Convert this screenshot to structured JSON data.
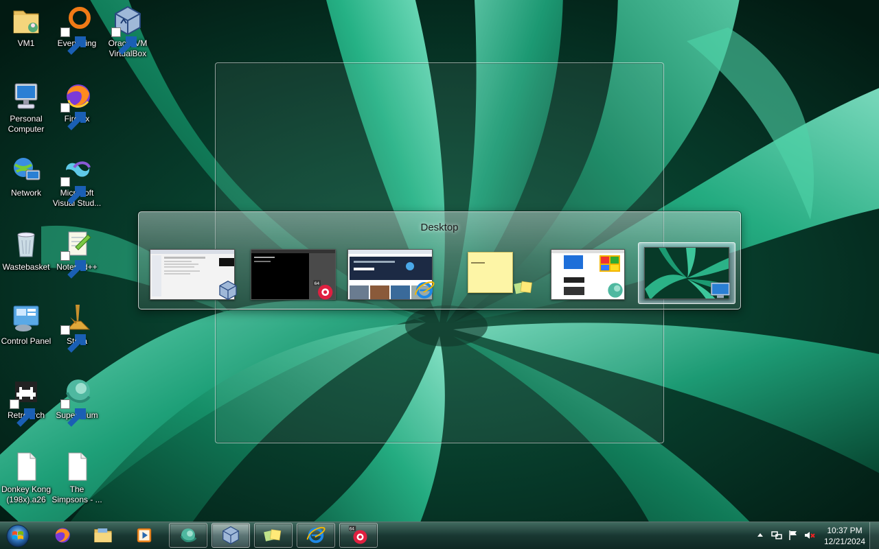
{
  "desktop": {
    "icons": [
      {
        "label": "VM1"
      },
      {
        "label": "Everything"
      },
      {
        "label": "Oracle VM VirtualBox"
      },
      {
        "label": "Personal Computer"
      },
      {
        "label": "Firefox"
      },
      {
        "label": "Network"
      },
      {
        "label": "Microsoft Visual Stud..."
      },
      {
        "label": "Wastebasket"
      },
      {
        "label": "Notepad++"
      },
      {
        "label": "Control Panel"
      },
      {
        "label": "Stella"
      },
      {
        "label": "RetroArch"
      },
      {
        "label": "Supermium"
      },
      {
        "label": "Donkey Kong (198x).a26"
      },
      {
        "label": "The Simpsons - ..."
      }
    ]
  },
  "switcher": {
    "title": "Desktop",
    "items": [
      {
        "app": "VirtualBox",
        "icon": "virtualbox-icon"
      },
      {
        "app": "RetroArch",
        "icon": "retroarch-icon"
      },
      {
        "app": "Internet Explorer",
        "icon": "ie-icon"
      },
      {
        "app": "Sticky Notes",
        "icon": "sticky-notes-icon"
      },
      {
        "app": "Supermium",
        "icon": "supermium-icon"
      },
      {
        "app": "Desktop",
        "icon": "desktop-icon",
        "selected": true
      }
    ]
  },
  "taskbar": {
    "pinned": [
      {
        "icon": "firefox-icon"
      },
      {
        "icon": "file-explorer-icon"
      },
      {
        "icon": "media-player-icon"
      },
      {
        "icon": "supermium-icon",
        "running": true
      },
      {
        "icon": "virtualbox-icon",
        "running": true,
        "active": true
      },
      {
        "icon": "sticky-notes-icon",
        "running": true
      },
      {
        "icon": "ie-icon",
        "running": true
      },
      {
        "icon": "retroarch-icon",
        "running": true
      }
    ],
    "tray": {
      "time": "10:37 PM",
      "date": "12/21/2024"
    }
  },
  "colors": {
    "accent": "#1f8f6a",
    "taskbar": "#1a3c35"
  }
}
